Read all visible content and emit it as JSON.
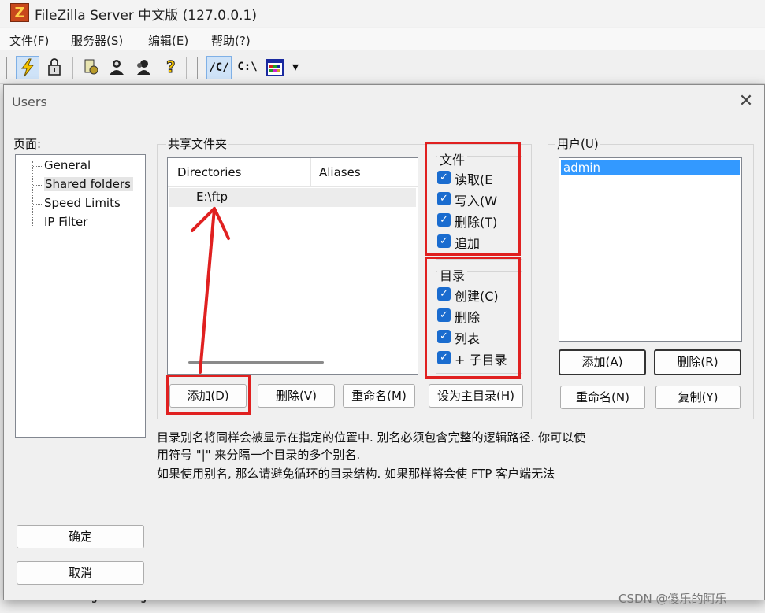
{
  "app": {
    "title": "FileZilla Server 中文版 (127.0.0.1)",
    "icon_glyph": "Z"
  },
  "menubar": {
    "items": [
      "文件(F)",
      "服务器(S)",
      "编辑(E)",
      "帮助(?)"
    ]
  },
  "toolbar": {
    "path_c_slash": "/C/",
    "path_c_backslash": "C:\\",
    "dropdown_glyph": "▾"
  },
  "log": {
    "text": "Done retrieving settings"
  },
  "dialog": {
    "title": "Users",
    "close_glyph": "✕",
    "pages_label": "页面:",
    "pages": [
      "General",
      "Shared folders",
      "Speed Limits",
      "IP Filter"
    ],
    "selected_page": "Shared folders",
    "shared_folders_label": "共享文件夹",
    "columns": [
      "Directories",
      "Aliases"
    ],
    "directories": [
      {
        "path": "E:\\ftp",
        "alias": ""
      }
    ],
    "files_group": {
      "label": "文件",
      "options": [
        "读取(E",
        "写入(W",
        "删除(T)",
        "追加"
      ]
    },
    "dirs_group": {
      "label": "目录",
      "options": [
        "创建(C)",
        "删除",
        "列表",
        "+ 子目录"
      ]
    },
    "folder_buttons": {
      "add": "添加(D)",
      "remove": "删除(V)",
      "rename": "重命名(M)",
      "set_home": "设为主目录(H)"
    },
    "users_label": "用户(U)",
    "users": [
      "admin"
    ],
    "user_buttons": {
      "add": "添加(A)",
      "remove": "删除(R)",
      "rename": "重命名(N)",
      "copy": "复制(Y)"
    },
    "info_line1": "目录别名将同样会被显示在指定的位置中. 别名必须包含完整的逻辑路径. 你可以使",
    "info_line2": "用符号 \"|\" 来分隔一个目录的多个别名.",
    "info_line3": "如果使用别名, 那么请避免循环的目录结构. 如果那样将会使 FTP 客户端无法",
    "ok": "确定",
    "cancel": "取消",
    "checkmark": "✓"
  },
  "watermark": "CSDN @傻乐的阿乐",
  "colors": {
    "annotation_red": "#e02020",
    "selection_blue": "#3399ff",
    "checkbox_blue": "#1a6ccf"
  }
}
